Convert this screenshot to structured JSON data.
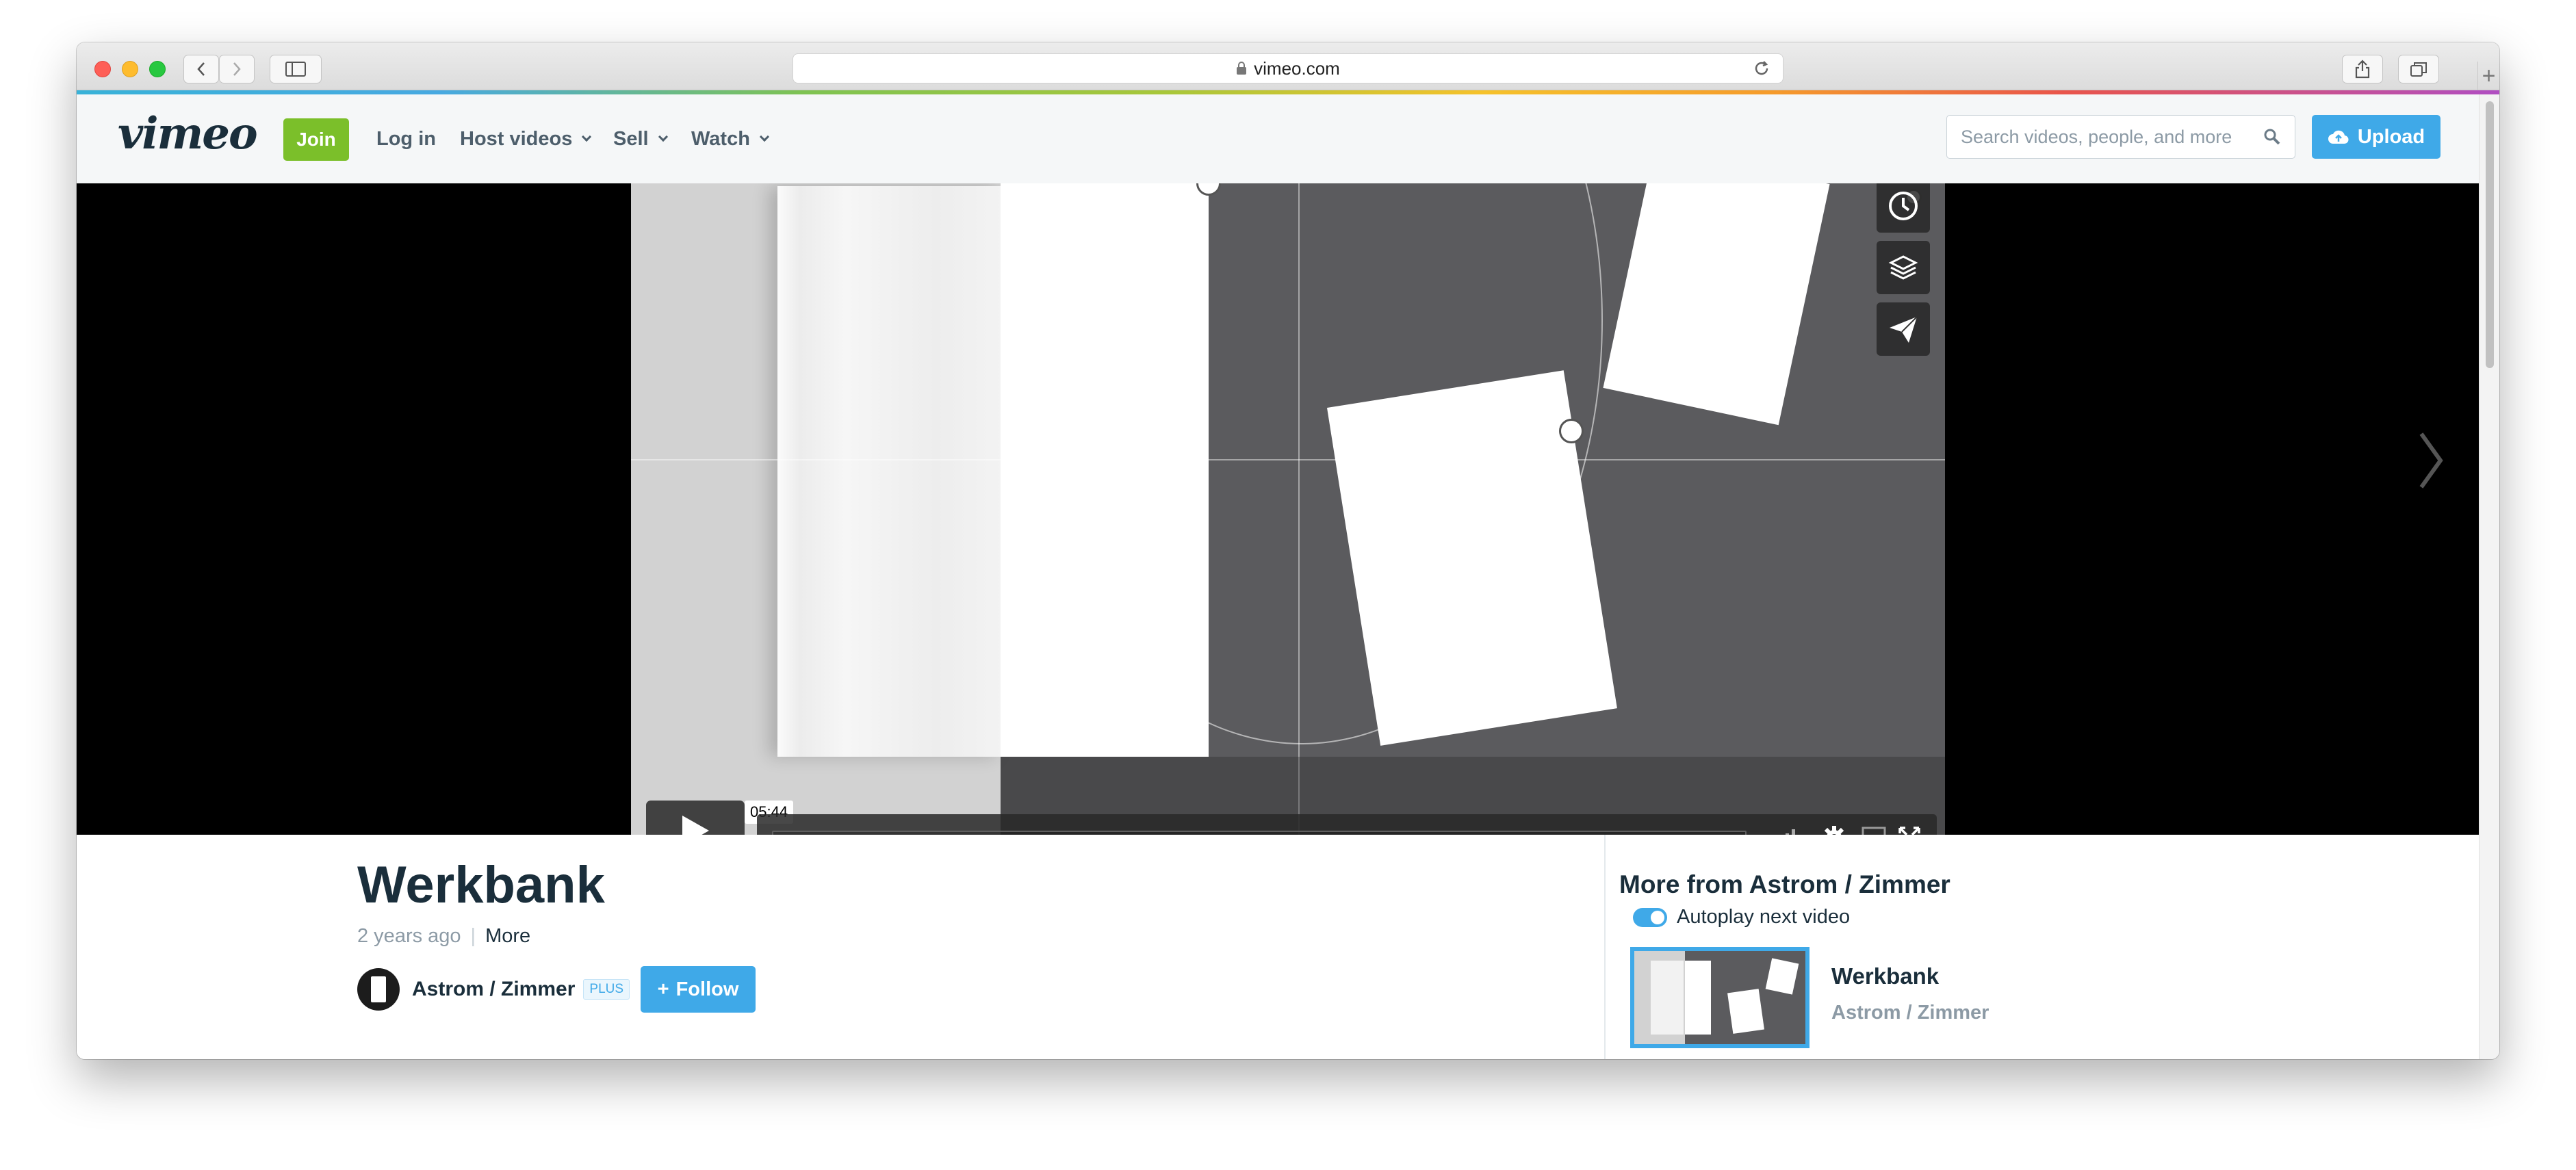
{
  "browser": {
    "url": "vimeo.com",
    "icons": [
      "back-icon",
      "forward-icon",
      "sidebar-icon",
      "lock-icon",
      "reload-icon",
      "share-icon",
      "tabs-icon",
      "new-tab-icon"
    ]
  },
  "header": {
    "logo": "vimeo",
    "join_label": "Join",
    "login_label": "Log in",
    "host_videos_label": "Host videos",
    "sell_label": "Sell",
    "watch_label": "Watch",
    "search_placeholder": "Search videos, people, and more",
    "upload_label": "Upload",
    "colors": {
      "join": "#7bbf2a",
      "accent": "#3fa9e8",
      "text": "#1a2e3b"
    }
  },
  "player": {
    "timestamp": "05:44",
    "progress": 0,
    "side_icons": [
      "watch-later-icon",
      "collections-icon",
      "share-icon"
    ],
    "control_icons": [
      "play-icon",
      "volume-icon",
      "settings-icon",
      "airplay-icon",
      "fullscreen-icon",
      "next-video-icon"
    ]
  },
  "video": {
    "title": "Werkbank",
    "posted": "2 years ago",
    "separator": "|",
    "more_label": "More",
    "owner": "Astrom / Zimmer",
    "badge": "PLUS",
    "follow_label": "Follow"
  },
  "sidebar": {
    "heading": "More from Astrom / Zimmer",
    "autoplay_label": "Autoplay next video",
    "autoplay_on": true,
    "items": [
      {
        "title": "Werkbank",
        "owner": "Astrom / Zimmer"
      }
    ]
  }
}
